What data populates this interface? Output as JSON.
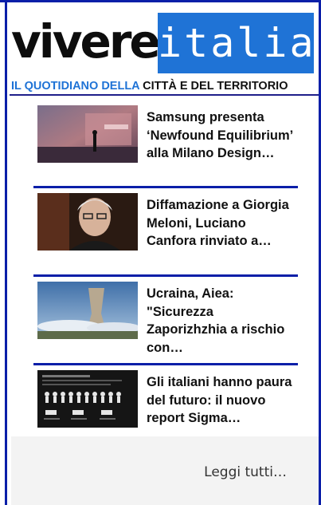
{
  "header": {
    "logo_left": "vivere",
    "logo_right": "italia",
    "tagline_part1": "IL QUOTIDIANO DELLA",
    "tagline_part2": "CITTÀ E DEL TERRITORIO"
  },
  "colors": {
    "accent_blue": "#1f73d6",
    "border_blue": "#0b1fa8"
  },
  "articles": [
    {
      "title": "Samsung presenta ‘Newfound Equilibrium’ alla Milano Design…",
      "thumbnail": "design-exhibition-photo"
    },
    {
      "title": "Diffamazione a Giorgia Meloni, Luciano Canfora rinviato a…",
      "thumbnail": "portrait-photo"
    },
    {
      "title": "Ucraina, Aiea: \"Sicurezza Zaporizhzhia a rischio con…",
      "thumbnail": "power-plant-photo"
    },
    {
      "title": "Gli italiani hanno paura del futuro: il nuovo report Sigma…",
      "thumbnail": "infographic-photo"
    }
  ],
  "footer": {
    "read_all": "Leggi tutti…"
  }
}
